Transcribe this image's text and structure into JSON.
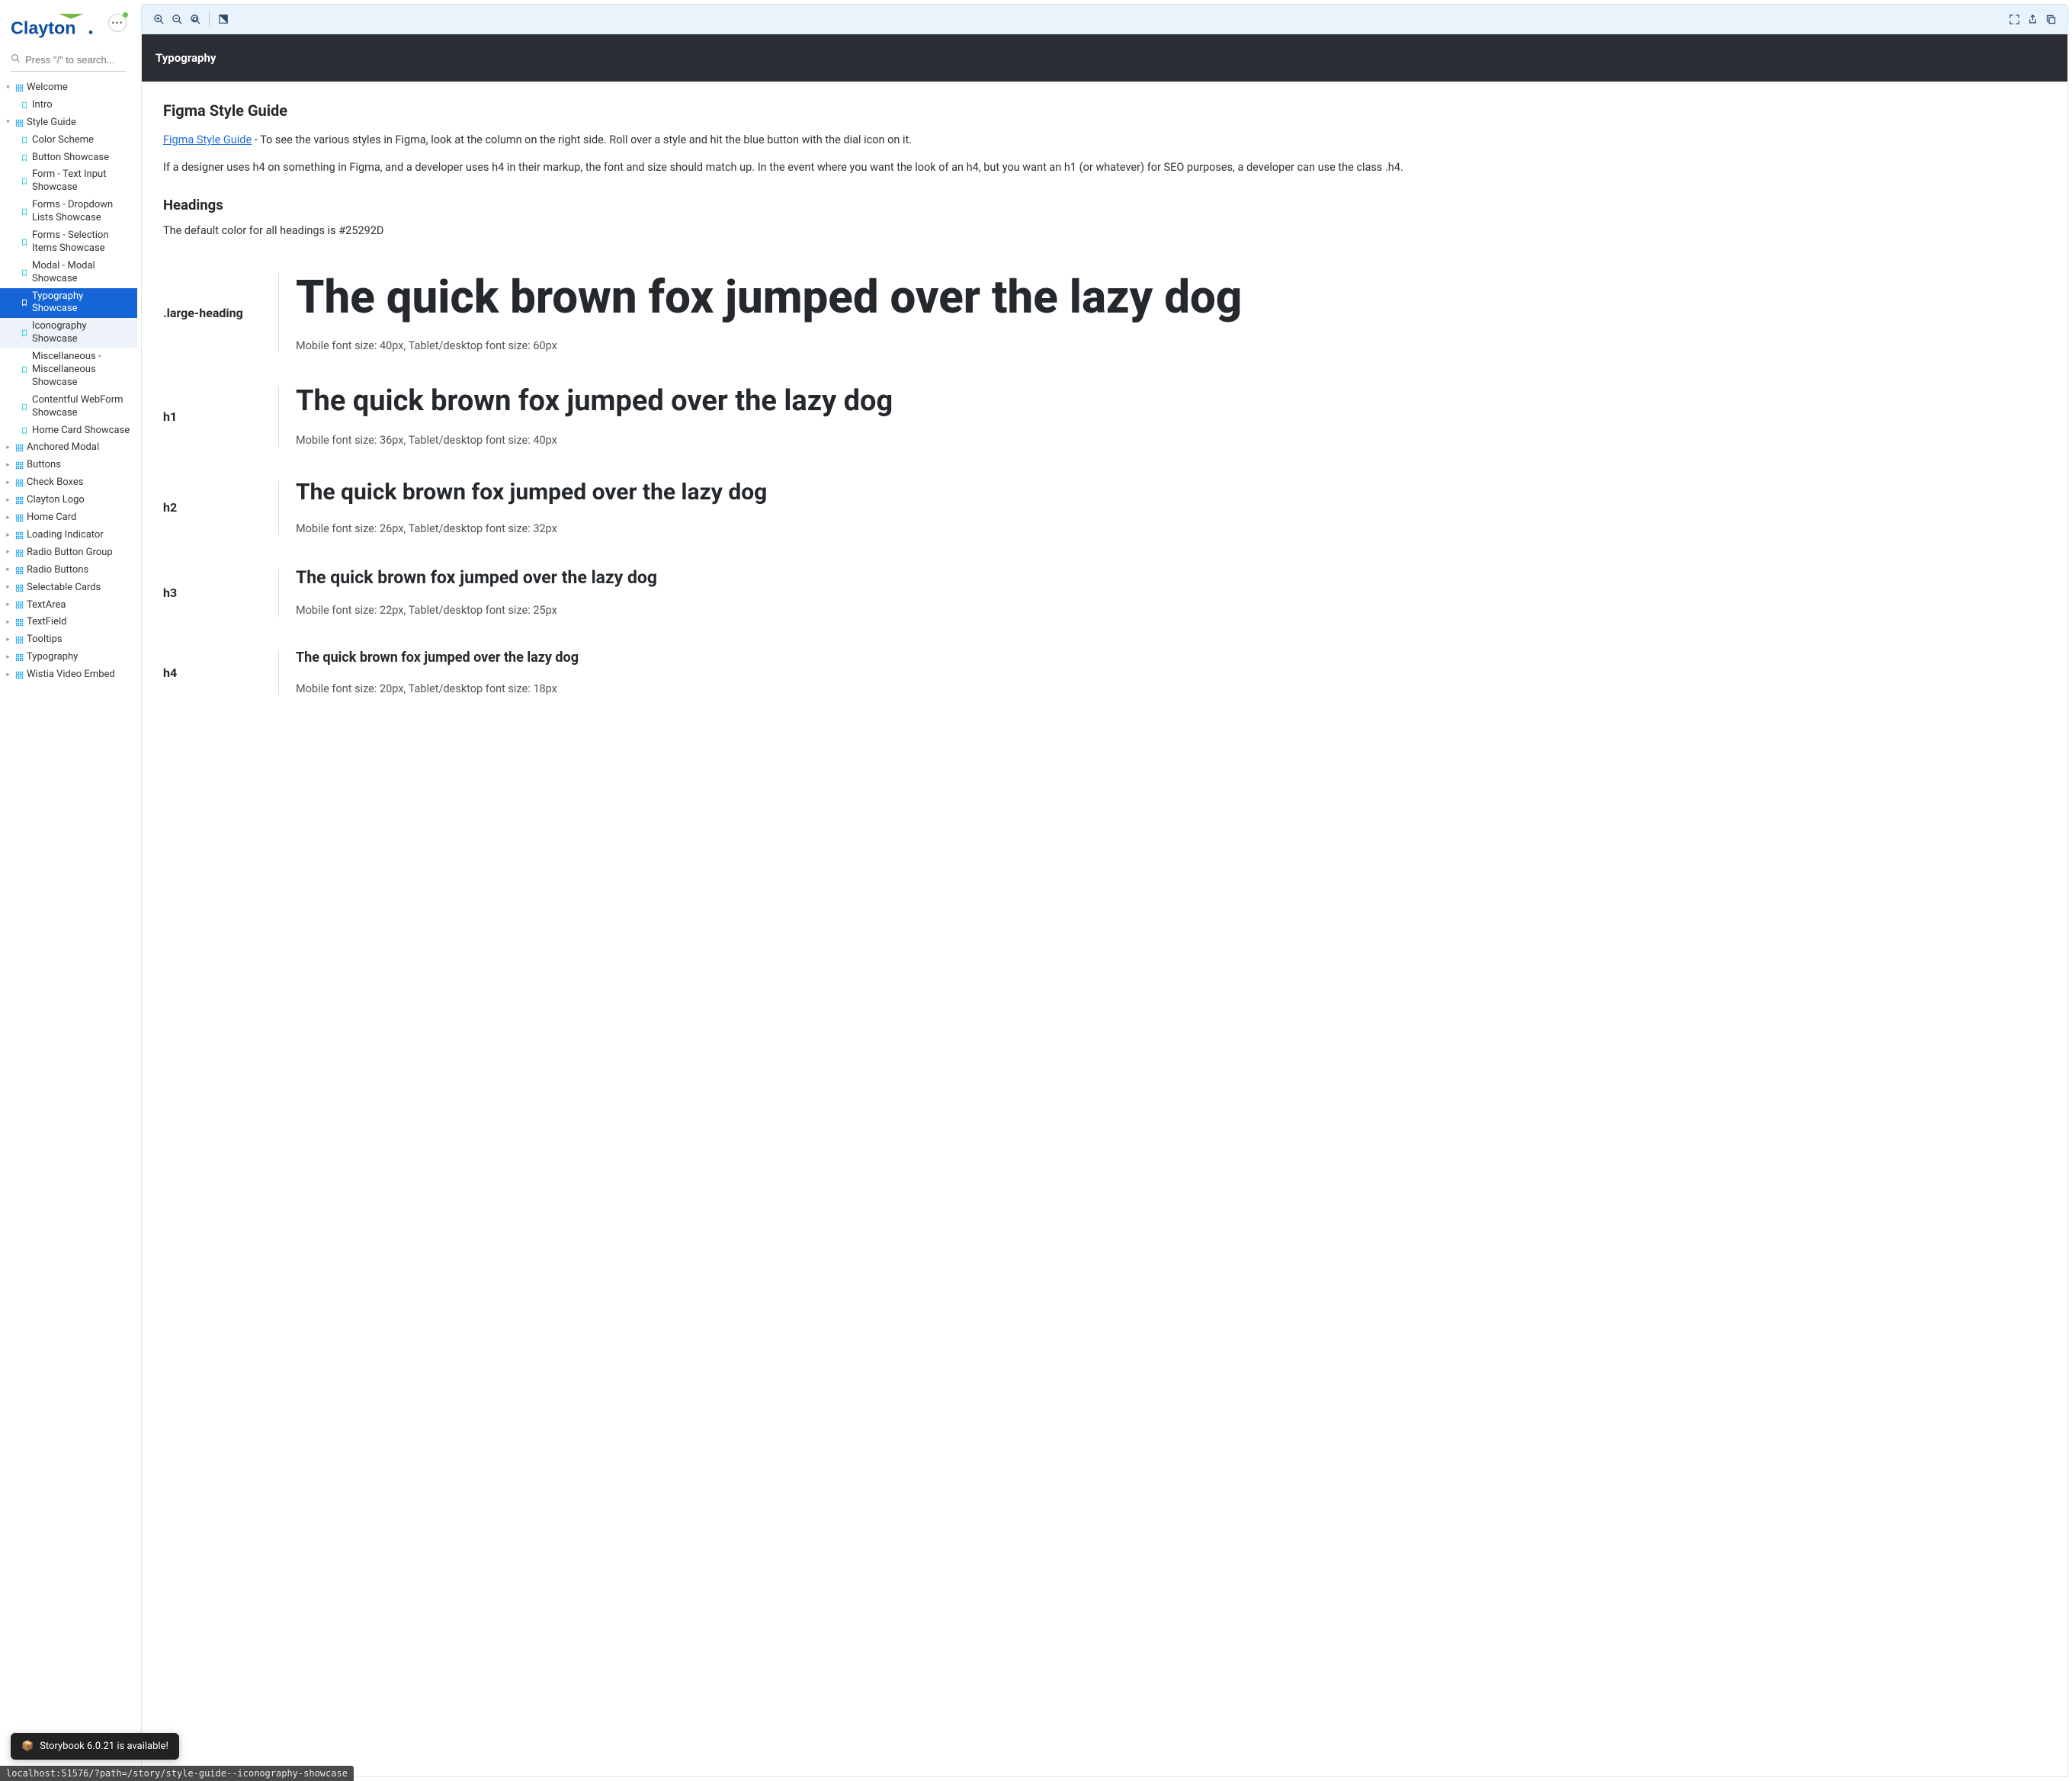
{
  "brand": {
    "name": "Clayton"
  },
  "search": {
    "placeholder": "Press \"/\" to search..."
  },
  "sidebar": {
    "groups": [
      {
        "label": "Welcome",
        "expanded": true,
        "children": [
          {
            "label": "Intro",
            "kind": "story"
          }
        ]
      },
      {
        "label": "Style Guide",
        "expanded": true,
        "children": [
          {
            "label": "Color Scheme",
            "kind": "story"
          },
          {
            "label": "Button Showcase",
            "kind": "story"
          },
          {
            "label": "Form - Text Input Showcase",
            "kind": "story"
          },
          {
            "label": "Forms - Dropdown Lists Showcase",
            "kind": "story"
          },
          {
            "label": "Forms - Selection Items Showcase",
            "kind": "story"
          },
          {
            "label": "Modal - Modal Showcase",
            "kind": "story"
          },
          {
            "label": "Typography Showcase",
            "kind": "story",
            "selected": true
          },
          {
            "label": "Iconography Showcase",
            "kind": "story",
            "hover": true
          },
          {
            "label": "Miscellaneous - Miscellaneous Showcase",
            "kind": "story"
          },
          {
            "label": "Contentful WebForm Showcase",
            "kind": "story"
          },
          {
            "label": "Home Card Showcase",
            "kind": "story"
          }
        ]
      },
      {
        "label": "Anchored Modal",
        "expanded": false
      },
      {
        "label": "Buttons",
        "expanded": false
      },
      {
        "label": "Check Boxes",
        "expanded": false
      },
      {
        "label": "Clayton Logo",
        "expanded": false
      },
      {
        "label": "Home Card",
        "expanded": false
      },
      {
        "label": "Loading Indicator",
        "expanded": false
      },
      {
        "label": "Radio Button Group",
        "expanded": false
      },
      {
        "label": "Radio Buttons",
        "expanded": false
      },
      {
        "label": "Selectable Cards",
        "expanded": false
      },
      {
        "label": "TextArea",
        "expanded": false
      },
      {
        "label": "TextField",
        "expanded": false
      },
      {
        "label": "Tooltips",
        "expanded": false
      },
      {
        "label": "Typography",
        "expanded": false
      },
      {
        "label": "Wistia Video Embed",
        "expanded": false
      }
    ]
  },
  "doc": {
    "banner": "Typography",
    "h_figma": "Figma Style Guide",
    "link_text": "Figma Style Guide",
    "p1_rest": " - To see the various styles in Figma, look at the column on the right side. Roll over a style and hit the blue button with the dial icon on it.",
    "p2": "If a designer uses h4 on something in Figma, and a developer uses h4 in their markup, the font and size should match up. In the event where you want the look of an h4, but you want an h1 (or whatever) for SEO purposes, a developer can use the class .h4.",
    "h_headings": "Headings",
    "headings_default": "The default color for all headings is #25292D",
    "sample_text": "The quick brown fox jumped over the lazy dog",
    "rows": [
      {
        "label": ".large-heading",
        "cls": "lh",
        "meta": "Mobile font size: 40px, Tablet/desktop font size: 60px"
      },
      {
        "label": "h1",
        "cls": "h1s",
        "meta": "Mobile font size: 36px, Tablet/desktop font size: 40px"
      },
      {
        "label": "h2",
        "cls": "h2s",
        "meta": "Mobile font size: 26px, Tablet/desktop font size: 32px"
      },
      {
        "label": "h3",
        "cls": "h3s",
        "meta": "Mobile font size: 22px, Tablet/desktop font size: 25px"
      },
      {
        "label": "h4",
        "cls": "h4s",
        "meta": "Mobile font size: 20px, Tablet/desktop font size: 18px"
      }
    ]
  },
  "toast": {
    "emoji": "📦",
    "text": "Storybook 6.0.21 is available!"
  },
  "statusbar": "localhost:51576/?path=/story/style-guide--iconography-showcase"
}
